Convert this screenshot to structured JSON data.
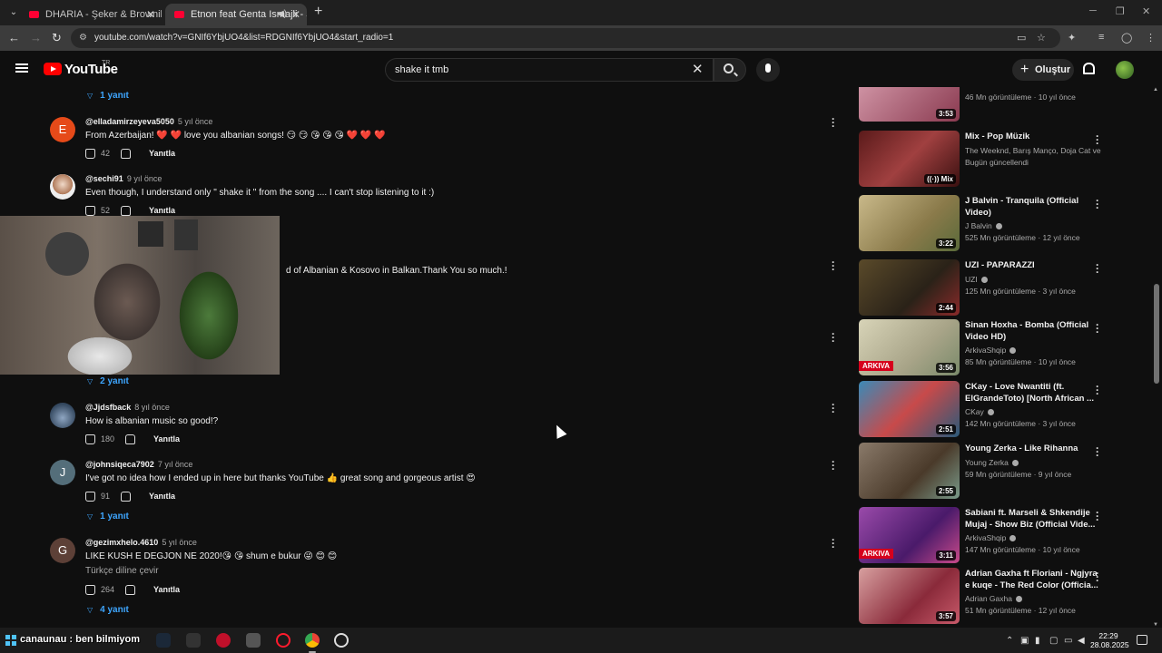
{
  "browser": {
    "tabs": [
      {
        "title": "DHARIA - Şeker & Browniler (M"
      },
      {
        "title": "Etnon feat Genta Ismajli - S"
      }
    ],
    "url": "youtube.com/watch?v=GNIf6YbjUO4&list=RDGNIf6YbjUO4&start_radio=1"
  },
  "header": {
    "logo_text": "YouTube",
    "region": "TR",
    "search_value": "shake it tmb",
    "create_label": "Oluştur"
  },
  "comments": {
    "top_replies": "1 yanıt",
    "items": [
      {
        "author": "@elladamirzeyeva5050",
        "time": "5 yıl önce",
        "text": "From Azerbaijan! ❤️ ❤️ love you albanian songs! 😏 😏 😘 😘 😘 ❤️ ❤️ ❤️",
        "likes": "42",
        "reply": "Yanıtla",
        "avatar_letter": "E",
        "avatar_color": "#e64a19"
      },
      {
        "author": "@sechi91",
        "time": "9 yıl önce",
        "text": "Even though, I understand only \" shake it \" from the song .... I can't stop listening to it :)",
        "likes": "52",
        "reply": "Yanıtla",
        "avatar_letter": "",
        "avatar_color": "#d7ccc8"
      },
      {
        "text_partial": "d of Albanian & Kosovo in Balkan.Thank You so much.!"
      },
      {
        "author": "@Jjdsfback",
        "time": "8 yıl önce",
        "text": "How is albanian music so good!?",
        "likes": "180",
        "reply": "Yanıtla",
        "avatar_letter": "",
        "avatar_color": "#455a64"
      },
      {
        "author": "@johnsiqeca7902",
        "time": "7 yıl önce",
        "text": "I've got no idea how I ended up in here but thanks YouTube 👍 great song and gorgeous artist 😍",
        "likes": "91",
        "reply": "Yanıtla",
        "avatar_letter": "J",
        "avatar_color": "#546e7a",
        "replies": "1 yanıt"
      },
      {
        "author": "@gezimxhelo.4610",
        "time": "5 yıl önce",
        "text": "LIKE KUSH E DEGJON NE 2020!😘 😘 shum e bukur 😜 😊 😊",
        "translate": "Türkçe diline çevir",
        "likes": "264",
        "reply": "Yanıtla",
        "avatar_letter": "G",
        "avatar_color": "#5d4037",
        "replies": "4 yanıt"
      }
    ],
    "hidden_replies": "2 yanıt"
  },
  "sidebar": [
    {
      "title": "",
      "channel": "",
      "meta": "46 Mn görüntüleme · 10 yıl önce",
      "duration": "3:53",
      "thumb": "#b85a6e"
    },
    {
      "title": "Mix - Pop Müzik",
      "channel": "The Weeknd, Barış Manço, Doja Cat ve d...",
      "meta": "Bugün güncellendi",
      "duration": "Mix",
      "thumb": "#7a2a2a"
    },
    {
      "title": "J Balvin - Tranquila (Official Video)",
      "channel": "J Balvin",
      "meta": "525 Mn görüntüleme · 12 yıl önce",
      "duration": "3:22",
      "thumb": "#9c8a5a"
    },
    {
      "title": "UZI - PAPARAZZI",
      "channel": "UZI",
      "meta": "125 Mn görüntüleme · 3 yıl önce",
      "duration": "2:44",
      "thumb": "#3a3222"
    },
    {
      "title": "Sinan Hoxha - Bomba (Official Video HD)",
      "channel": "ArkivaShqip",
      "meta": "85 Mn görüntüleme · 10 yıl önce",
      "duration": "3:56",
      "thumb": "#b8b49a"
    },
    {
      "title": "CKay - Love Nwantiti (ft. ElGrandeToto) [North African ...",
      "channel": "CKay",
      "meta": "142 Mn görüntüleme · 3 yıl önce",
      "duration": "2:51",
      "thumb": "#2f6f8f"
    },
    {
      "title": "Young Zerka - Like Rihanna",
      "channel": "Young Zerka",
      "meta": "59 Mn görüntüleme · 9 yıl önce",
      "duration": "2:55",
      "thumb": "#6a5a4a"
    },
    {
      "title": "Sabiani ft. Marseli & Shkendije Mujaj - Show Biz (Official Vide...",
      "channel": "ArkivaShqip",
      "meta": "147 Mn görüntüleme · 10 yıl önce",
      "duration": "3:11",
      "thumb": "#7a3a8a"
    },
    {
      "title": "Adrian Gaxha ft Floriani - Ngjyra e kuqe - The Red Color (Officia...",
      "channel": "Adrian Gaxha",
      "meta": "51 Mn görüntüleme · 12 yıl önce",
      "duration": "3:57",
      "thumb": "#8a3a4a"
    }
  ],
  "badges": {
    "arkiva": "ARKIVA"
  },
  "taskbar": {
    "overlay": "canaunau : ben bilmiyom",
    "time": "22:29",
    "date": "28.08.2025"
  }
}
